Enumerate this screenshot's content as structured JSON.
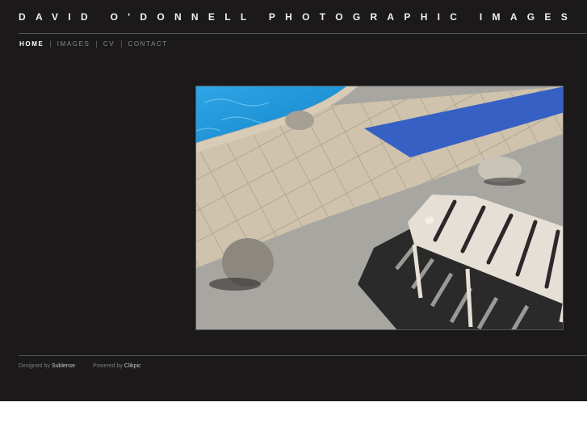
{
  "header": {
    "title": "DAVID O'DONNELL PHOTOGRAPHIC IMAGES"
  },
  "nav": {
    "items": [
      {
        "label": "HOME",
        "active": true
      },
      {
        "label": "IMAGES",
        "active": false
      },
      {
        "label": "CV",
        "active": false
      },
      {
        "label": "CONTACT",
        "active": false
      }
    ],
    "separator": "|"
  },
  "footer": {
    "designed_prefix": "Designed by",
    "designed_link": "Sublense",
    "powered_prefix": "Powered by",
    "powered_link": "Clikpic"
  },
  "colors": {
    "background": "#1b191a",
    "title_text": "#f0f0f0",
    "nav_active": "#ffffff",
    "nav_inactive": "#8a8a8a"
  }
}
